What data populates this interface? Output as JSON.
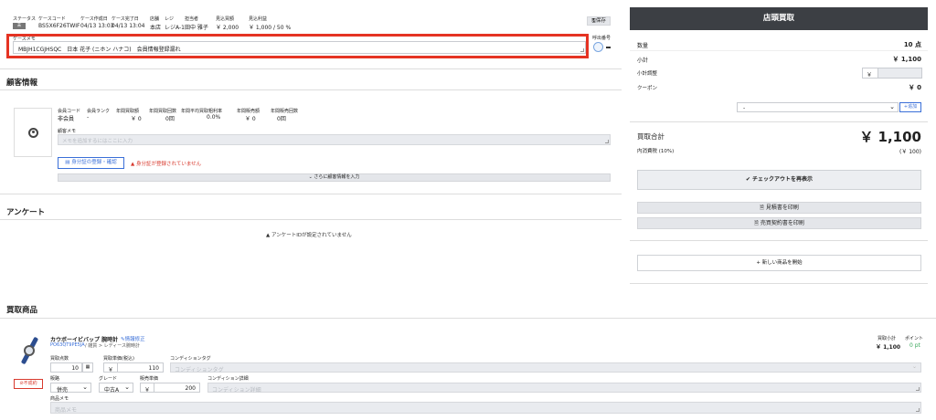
{
  "header": {
    "labels": [
      "ステータス",
      "ケースコード",
      "ケース作成日",
      "ケース完了日",
      "店舗",
      "レジ",
      "担当者",
      "見込買額",
      "見込利益"
    ],
    "status_badge": "未",
    "case_code": "BS5X6F26TWIF",
    "created": "04/13 13:03",
    "completed": "04/13 13:04",
    "store": "本店",
    "register": "レジA-1",
    "staff": "田中 雅子",
    "expected_price": "￥ 2,000",
    "expected_profit": "￥ 1,000 / 50 %",
    "save_button": "保存",
    "case_memo_label": "ケースメモ",
    "case_memo_value": "MBJH1CGJHSQC　日本 花子 (ニホン ハナコ)　会員情報登録漏れ",
    "call_number_label": "呼出番号"
  },
  "customer": {
    "section_title": "顧客情報",
    "col_labels": [
      "会員コード",
      "会員ランク",
      "年間買取額",
      "年間買取回数",
      "年間平均買取粗利率",
      "年間販売額",
      "年間販売回数"
    ],
    "col_values": [
      "非会員",
      "-",
      "￥ 0",
      "0回",
      "0.0%",
      "￥ 0",
      "0回"
    ],
    "memo_label": "顧客メモ",
    "memo_placeholder": "メモを追加するにはここに入力",
    "id_button": "身分証の登録・確認",
    "id_warning": "身分証が登録されていません",
    "more_button": "さらに顧客情報を入力"
  },
  "survey": {
    "section_title": "アンケート",
    "empty_message": "アンケートIDが設定されていません"
  },
  "items": {
    "section_title": "買取商品",
    "product_name": "カウボーイビバップ 腕時計",
    "edit_link": "情報修正",
    "product_code": "PO63QT9PE5JA",
    "category_path": "/ 雑貨 > レディース腕時計",
    "subtotal_label": "買取小計",
    "subtotal_value": "￥ 1,100",
    "points_label": "ポイント",
    "points_value": "0 pt",
    "qty_label": "買取点数",
    "qty_value": "10",
    "unit_price_label": "買取単価(税込)",
    "unit_price_value": "110",
    "condition_tag_label": "コンディションタグ",
    "condition_tag_placeholder": "コンディションタグ",
    "status_tag": "不成約",
    "sales_label": "販路",
    "sales_value": "併売",
    "grade_label": "グレード",
    "grade_value": "中古A",
    "sell_price_label": "販売単価",
    "sell_price_value": "200",
    "condition_detail_label": "コンディション詳細",
    "condition_detail_placeholder": "コンディション詳細",
    "memo_label": "商品メモ",
    "memo_placeholder": "商品メモ",
    "yen": "￥"
  },
  "right": {
    "title": "店頭買取",
    "qty_label": "数量",
    "qty_value": "10 点",
    "subtotal_label": "小計",
    "subtotal_value": "￥ 1,100",
    "adjust_label": "小計調整",
    "yen": "￥",
    "coupon_label": "クーポン",
    "coupon_value": "￥ 0",
    "coupon_select": "-",
    "add_button": "追加",
    "total_label": "買取合計",
    "total_value": "￥ 1,100",
    "tax_label": "内消費税 (10%)",
    "tax_value": "(￥ 100)",
    "checkout_button": "チェックアウトを再表示",
    "estimate_button": "見積書を印刷",
    "contract_button": "売買契約書を印刷",
    "new_item_button": "新しい商品を開始"
  },
  "colors": {
    "highlight": "#e53323",
    "dark": "#3c3f44",
    "link": "#3a6fd8",
    "warn": "#d83a2e",
    "green": "#3aa75b"
  }
}
